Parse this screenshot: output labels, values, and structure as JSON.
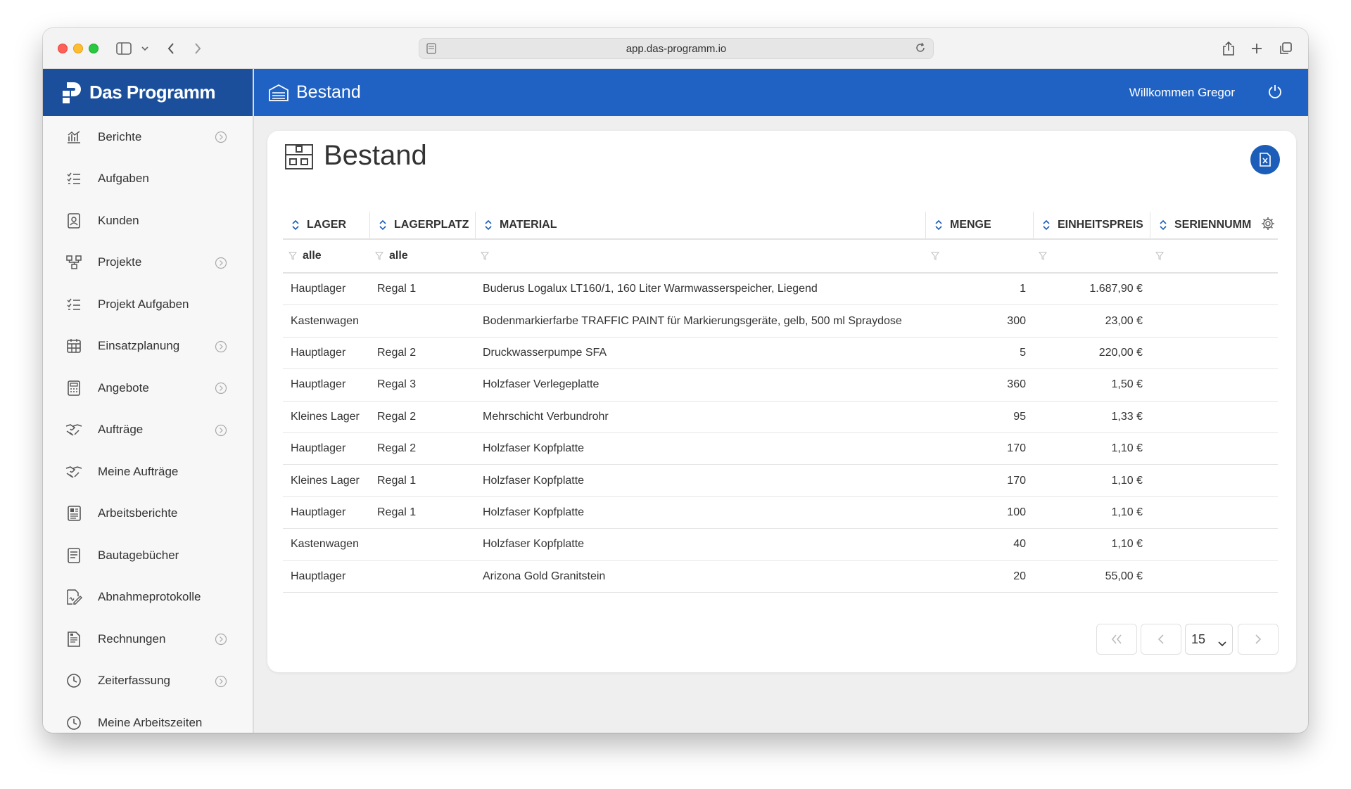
{
  "browser": {
    "url": "app.das-programm.io"
  },
  "brand": {
    "name": "Das Programm"
  },
  "header": {
    "title": "Bestand",
    "welcome": "Willkommen Gregor"
  },
  "sidebar": {
    "items": [
      {
        "label": "Berichte",
        "icon": "chart-icon",
        "expandable": true
      },
      {
        "label": "Aufgaben",
        "icon": "task-list-icon",
        "expandable": false
      },
      {
        "label": "Kunden",
        "icon": "contact-icon",
        "expandable": false
      },
      {
        "label": "Projekte",
        "icon": "project-icon",
        "expandable": true
      },
      {
        "label": "Projekt Aufgaben",
        "icon": "task-list-icon",
        "expandable": false
      },
      {
        "label": "Einsatzplanung",
        "icon": "calendar-icon",
        "expandable": true
      },
      {
        "label": "Angebote",
        "icon": "calculator-icon",
        "expandable": true
      },
      {
        "label": "Aufträge",
        "icon": "handshake-icon",
        "expandable": true
      },
      {
        "label": "Meine Aufträge",
        "icon": "handshake-icon",
        "expandable": false
      },
      {
        "label": "Arbeitsberichte",
        "icon": "report-icon",
        "expandable": false
      },
      {
        "label": "Bautagebücher",
        "icon": "book-icon",
        "expandable": false
      },
      {
        "label": "Abnahmeprotokolle",
        "icon": "signature-icon",
        "expandable": false
      },
      {
        "label": "Rechnungen",
        "icon": "invoice-icon",
        "expandable": true
      },
      {
        "label": "Zeiterfassung",
        "icon": "clock-icon",
        "expandable": true
      },
      {
        "label": "Meine Arbeitszeiten",
        "icon": "clock-icon",
        "expandable": false
      }
    ]
  },
  "page": {
    "title": "Bestand"
  },
  "table": {
    "columns": [
      "LAGER",
      "LAGERPLATZ",
      "MATERIAL",
      "MENGE",
      "EINHEITSPREIS",
      "SERIENNUMM"
    ],
    "filters": {
      "lager": "alle",
      "lagerplatz": "alle"
    },
    "rows": [
      {
        "lager": "Hauptlager",
        "platz": "Regal 1",
        "material": "Buderus Logalux LT160/1, 160 Liter Warmwasserspeicher, Liegend",
        "menge": "1",
        "preis": "1.687,90 €",
        "serie": ""
      },
      {
        "lager": "Kastenwagen",
        "platz": "",
        "material": "Bodenmarkierfarbe TRAFFIC PAINT für Markierungsgeräte, gelb, 500 ml Spraydose",
        "menge": "300",
        "preis": "23,00 €",
        "serie": ""
      },
      {
        "lager": "Hauptlager",
        "platz": "Regal 2",
        "material": "Druckwasserpumpe SFA",
        "menge": "5",
        "preis": "220,00 €",
        "serie": ""
      },
      {
        "lager": "Hauptlager",
        "platz": "Regal 3",
        "material": "Holzfaser Verlegeplatte",
        "menge": "360",
        "preis": "1,50 €",
        "serie": ""
      },
      {
        "lager": "Kleines Lager",
        "platz": "Regal 2",
        "material": "Mehrschicht Verbundrohr",
        "menge": "95",
        "preis": "1,33 €",
        "serie": ""
      },
      {
        "lager": "Hauptlager",
        "platz": "Regal 2",
        "material": "Holzfaser Kopfplatte",
        "menge": "170",
        "preis": "1,10 €",
        "serie": ""
      },
      {
        "lager": "Kleines Lager",
        "platz": "Regal 1",
        "material": "Holzfaser Kopfplatte",
        "menge": "170",
        "preis": "1,10 €",
        "serie": ""
      },
      {
        "lager": "Hauptlager",
        "platz": "Regal 1",
        "material": "Holzfaser Kopfplatte",
        "menge": "100",
        "preis": "1,10 €",
        "serie": ""
      },
      {
        "lager": "Kastenwagen",
        "platz": "",
        "material": "Holzfaser Kopfplatte",
        "menge": "40",
        "preis": "1,10 €",
        "serie": ""
      },
      {
        "lager": "Hauptlager",
        "platz": "",
        "material": "Arizona Gold Granitstein",
        "menge": "20",
        "preis": "55,00 €",
        "serie": ""
      }
    ]
  },
  "pagination": {
    "page_size": "15"
  },
  "colors": {
    "brand_dark": "#1b4f9c",
    "brand": "#2062c4",
    "accent": "#1b5db8"
  }
}
